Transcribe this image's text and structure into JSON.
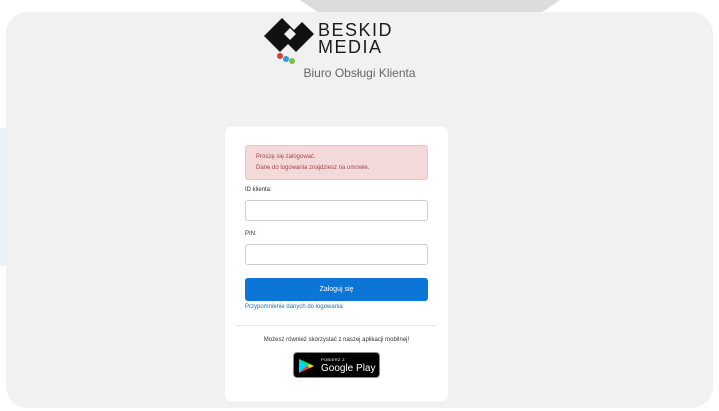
{
  "brand": {
    "line1": "BESKID",
    "line2": "MEDIA",
    "subtitle": "Biuro Obsługi Klienta"
  },
  "login": {
    "alert_line1": "Proszę się zalogować.",
    "alert_line2": "Dane do logowania znajdziesz na umowie.",
    "client_id_label": "ID klienta:",
    "client_id_value": "",
    "pin_label": "PIN:",
    "pin_value": "",
    "submit_label": "Zaloguj się",
    "reminder_link": "Przypomnienie danych do logowania"
  },
  "mobile": {
    "text": "Możesz również skorzystać z naszej aplikacji mobilnej!",
    "badge_small": "POBIERZ Z",
    "badge_big": "Google Play"
  },
  "colors": {
    "primary": "#0b76d8",
    "alert_bg": "#f3d9da",
    "alert_text": "#a94442",
    "page_bg": "#f1f1f1"
  }
}
